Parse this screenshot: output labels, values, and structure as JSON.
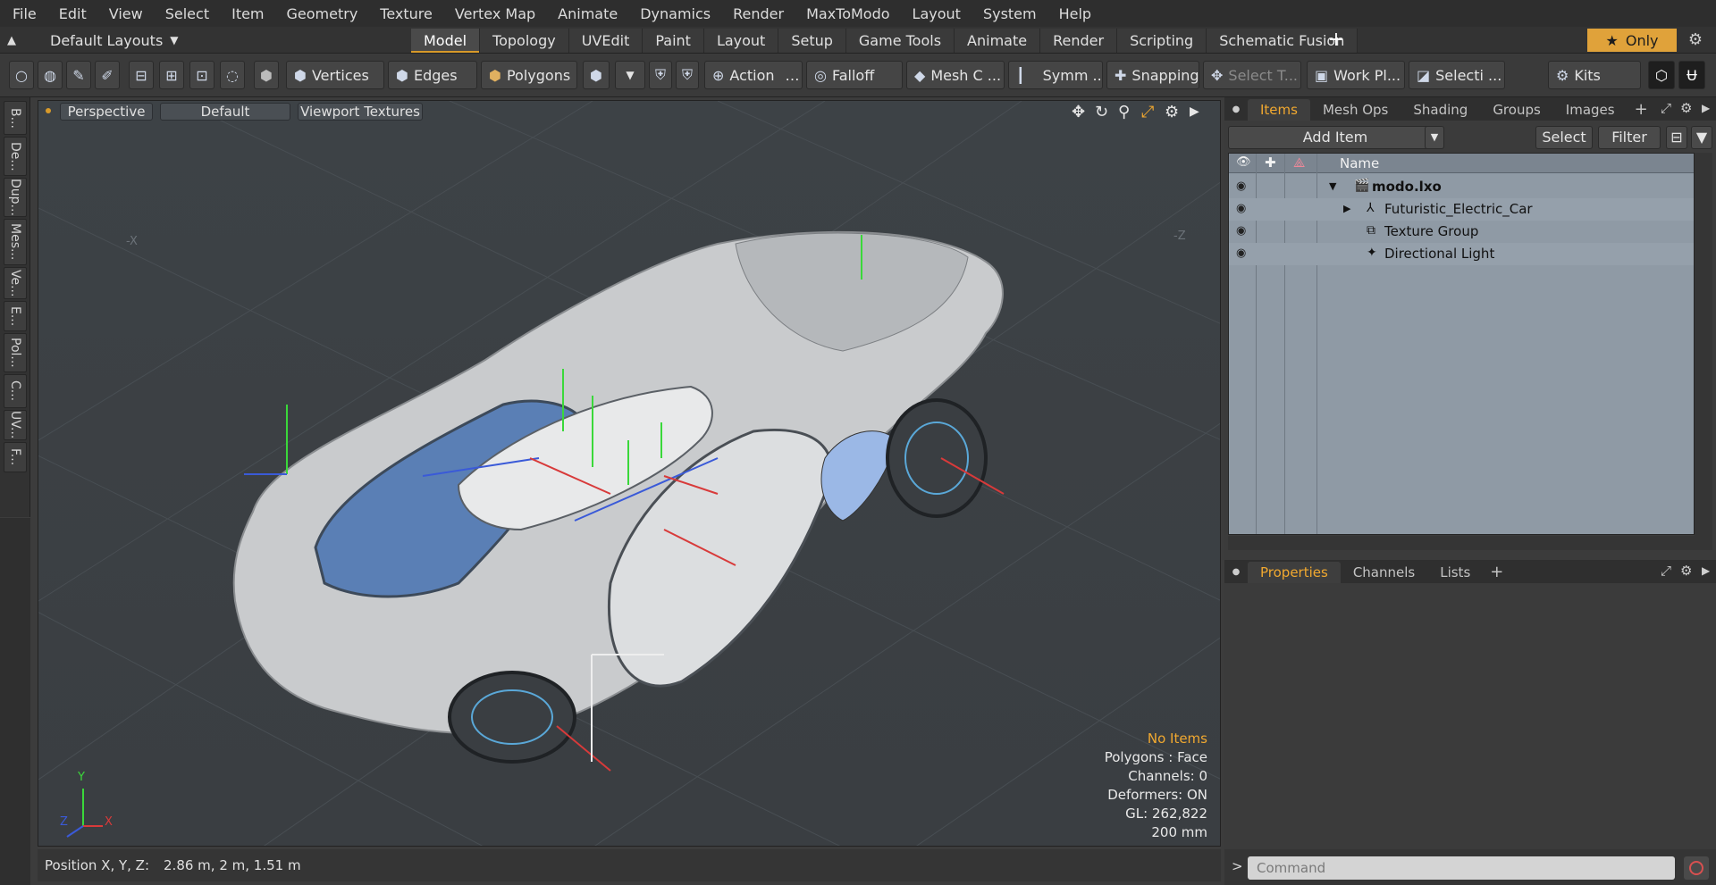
{
  "menu": [
    "File",
    "Edit",
    "View",
    "Select",
    "Item",
    "Geometry",
    "Texture",
    "Vertex Map",
    "Animate",
    "Dynamics",
    "Render",
    "MaxToModo",
    "Layout",
    "System",
    "Help"
  ],
  "layout": {
    "name": "Default Layouts",
    "only_label": "Only"
  },
  "tabs": [
    {
      "label": "Model",
      "active": true
    },
    {
      "label": "Topology"
    },
    {
      "label": "UVEdit"
    },
    {
      "label": "Paint"
    },
    {
      "label": "Layout"
    },
    {
      "label": "Setup"
    },
    {
      "label": "Game Tools"
    },
    {
      "label": "Animate"
    },
    {
      "label": "Render"
    },
    {
      "label": "Scripting"
    },
    {
      "label": "Schematic Fusion"
    }
  ],
  "toolbar": {
    "vertices": "Vertices",
    "edges": "Edges",
    "polygons": "Polygons",
    "action": "Action",
    "falloff": "Falloff",
    "mesh": "Mesh C ...",
    "symmetry": "Symm ...",
    "snapping": "Snapping",
    "select_t": "Select T...",
    "workplane": "Work Pl...",
    "selection": "Selecti ...",
    "kits": "Kits"
  },
  "left_tabs": [
    "B...",
    "De...",
    "Dup...",
    "Mes...",
    "Ve...",
    "E...",
    "Pol...",
    "C...",
    "UV...",
    "F..."
  ],
  "viewport": {
    "perspective": "Perspective",
    "shading": "Default",
    "textures": "Viewport Textures",
    "axis_labels": [
      "-X",
      "-Z"
    ],
    "gizmo": {
      "y": "Y",
      "x": "X",
      "z": "Z"
    },
    "info": [
      "No Items",
      "Polygons : Face",
      "Channels: 0",
      "Deformers: ON",
      "GL: 262,822",
      "200 mm"
    ]
  },
  "status": {
    "label": "Position X, Y, Z:",
    "value": "2.86 m, 2 m, 1.51 m"
  },
  "items_panel": {
    "tabs": [
      "Items",
      "Mesh Ops",
      "Shading",
      "Groups",
      "Images"
    ],
    "add_item": "Add Item",
    "select": "Select",
    "filter": "Filter",
    "name_header": "Name",
    "rows": [
      {
        "name": "modo.lxo",
        "icon": "scene-icon"
      },
      {
        "name": "Futuristic_Electric_Car",
        "icon": "mesh-locator-icon"
      },
      {
        "name": "Texture Group",
        "icon": "texture-group-icon"
      },
      {
        "name": "Directional Light",
        "icon": "light-icon"
      }
    ]
  },
  "properties_panel": {
    "tabs": [
      "Properties",
      "Channels",
      "Lists"
    ]
  },
  "command": {
    "placeholder": "Command",
    "prompt": ">"
  },
  "colors": {
    "accent": "#e0a23a",
    "tree_bg": "#8f9aa5",
    "axis_x": "#d83a3a",
    "axis_y": "#3ad83a",
    "axis_z": "#3a5ad8"
  }
}
